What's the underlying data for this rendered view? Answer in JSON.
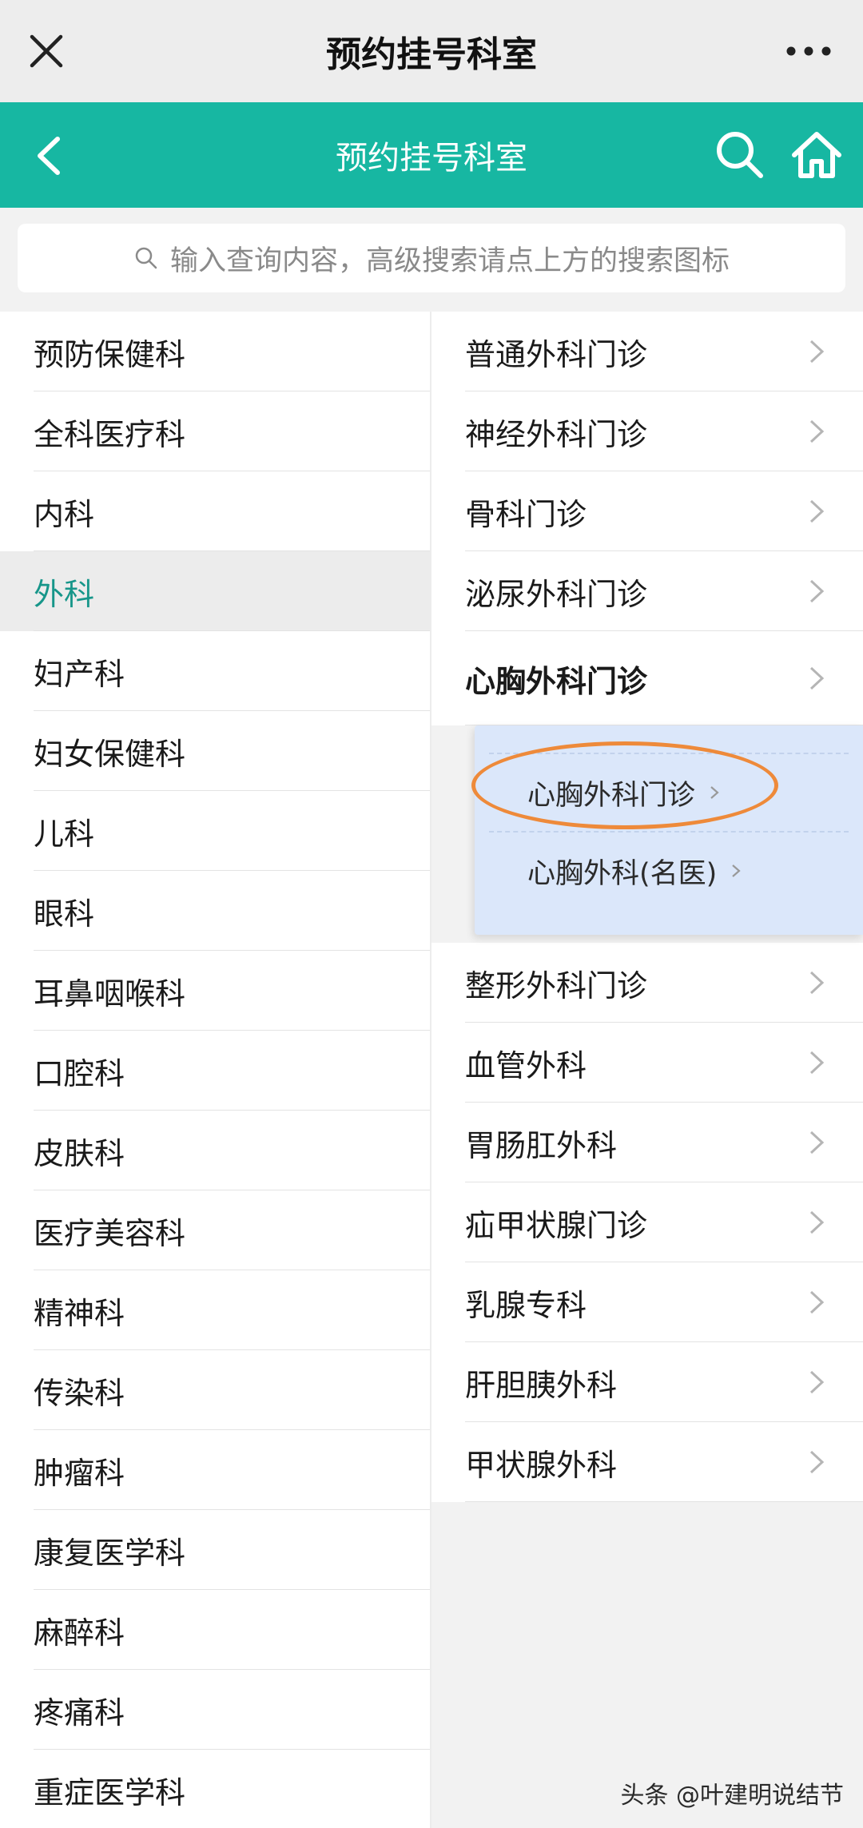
{
  "wechat_bar": {
    "title": "预约挂号科室"
  },
  "header": {
    "title": "预约挂号科室"
  },
  "search": {
    "placeholder": "输入查询内容，高级搜索请点上方的搜索图标"
  },
  "left_items": [
    "预防保健科",
    "全科医疗科",
    "内科",
    "外科",
    "妇产科",
    "妇女保健科",
    "儿科",
    "眼科",
    "耳鼻咽喉科",
    "口腔科",
    "皮肤科",
    "医疗美容科",
    "精神科",
    "传染科",
    "肿瘤科",
    "康复医学科",
    "麻醉科",
    "疼痛科",
    "重症医学科"
  ],
  "left_active": "外科",
  "right_items": [
    "普通外科门诊",
    "神经外科门诊",
    "骨科门诊",
    "泌尿外科门诊",
    "心胸外科门诊",
    "整形外科门诊",
    "血管外科",
    "胃肠肛外科",
    "疝甲状腺门诊",
    "乳腺专科",
    "肝胆胰外科",
    "甲状腺外科"
  ],
  "popup": {
    "items": [
      "心胸外科门诊",
      "心胸外科(名医)"
    ]
  },
  "watermark": "头条 @叶建明说结节",
  "colors": {
    "teal": "#17b7a2",
    "active_text": "#17968a",
    "popup_bg": "#dbe7fa",
    "ring": "#ee8a3a"
  }
}
